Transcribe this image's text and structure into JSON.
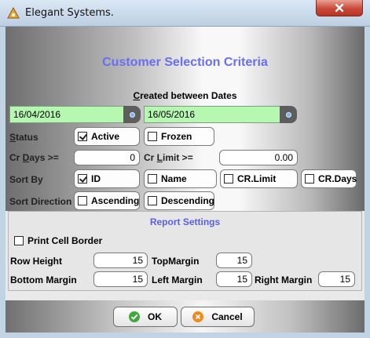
{
  "window": {
    "title": "Elegant Systems."
  },
  "heading": "Customer Selection Criteria",
  "date_range": {
    "label": "Created between Dates",
    "from": "16/04/2016",
    "to": "16/05/2016"
  },
  "status": {
    "label": "Status",
    "options": [
      {
        "label": "Active",
        "checked": true
      },
      {
        "label": "Frozen",
        "checked": false
      }
    ]
  },
  "cr_days": {
    "label": "Cr Days >=",
    "value": "0"
  },
  "cr_limit": {
    "label": "Cr Limit >=",
    "value": "0.00"
  },
  "sort_by": {
    "label": "Sort By",
    "options": [
      {
        "label": "ID",
        "checked": true
      },
      {
        "label": "Name",
        "checked": false
      },
      {
        "label": "CR.Limit",
        "checked": false
      },
      {
        "label": "CR.Days",
        "checked": false
      }
    ]
  },
  "sort_direction": {
    "label": "Sort Direction",
    "options": [
      {
        "label": "Ascending",
        "checked": false
      },
      {
        "label": "Descending",
        "checked": false
      }
    ]
  },
  "report_settings": {
    "title": "Report Settings",
    "print_cell_border": {
      "label": "Print Cell Border",
      "checked": false
    },
    "row_height": {
      "label": "Row Height",
      "value": "15"
    },
    "top_margin": {
      "label": "TopMargin",
      "value": "15"
    },
    "bottom_margin": {
      "label": "Bottom Margin",
      "value": "15"
    },
    "left_margin": {
      "label": "Left Margin",
      "value": "15"
    },
    "right_margin": {
      "label": "Right Margin",
      "value": "15"
    }
  },
  "buttons": {
    "ok": "OK",
    "cancel": "Cancel"
  },
  "colors": {
    "heading": "#6a6ef0",
    "date_field": "#b6f7b1",
    "ok_icon": "#3fa83f",
    "cancel_icon": "#f08a1e",
    "close_button": "#c8493a"
  },
  "icons": {
    "app": "app-logo-icon",
    "close": "close-icon",
    "calendar": "calendar-icon",
    "ok": "check-icon",
    "cancel": "cancel-icon"
  }
}
